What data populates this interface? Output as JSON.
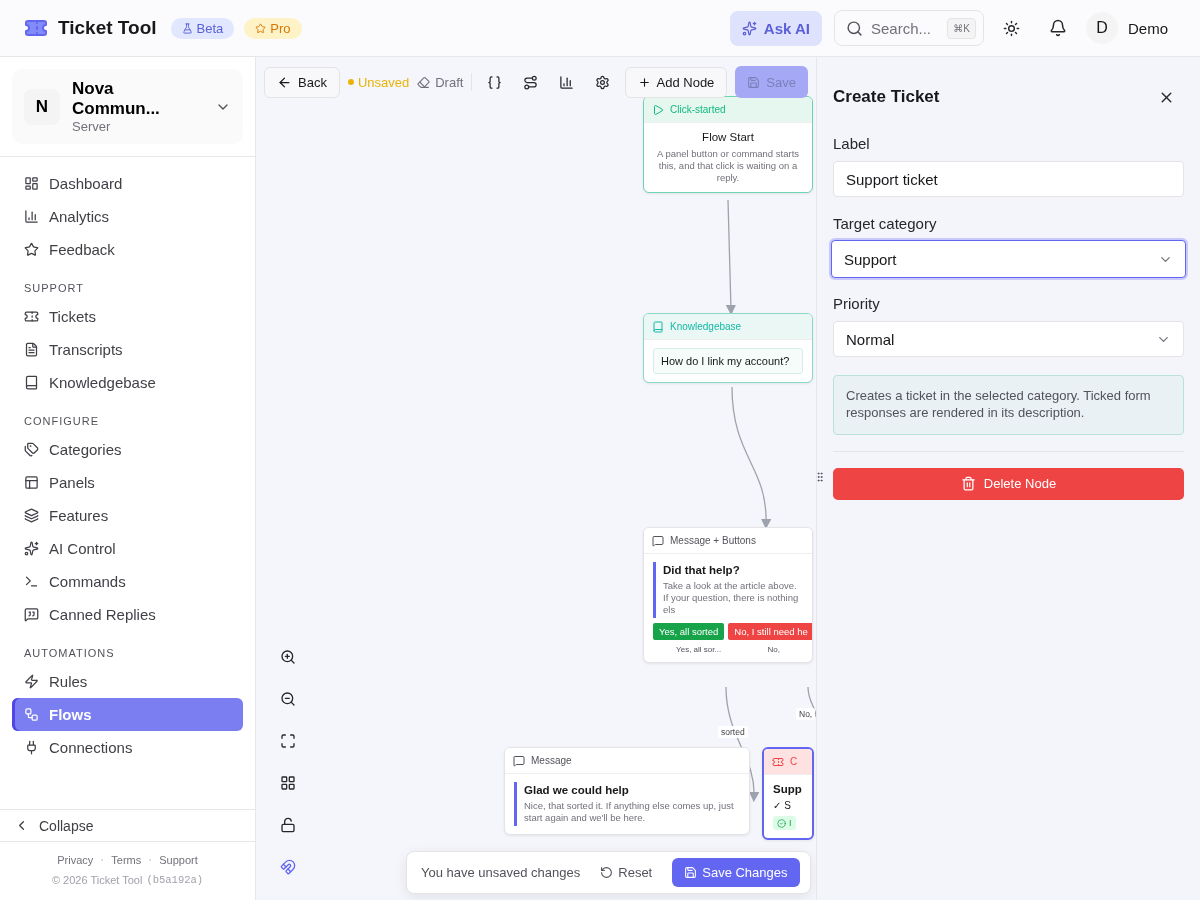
{
  "header": {
    "brand": "Ticket Tool",
    "badges": [
      {
        "kind": "beta",
        "label": "Beta"
      },
      {
        "kind": "pro",
        "label": "Pro"
      }
    ],
    "ask_ai": "Ask AI",
    "search": {
      "placeholder": "Search...",
      "shortcut": "⌘K"
    },
    "user": {
      "initial": "D",
      "name": "Demo"
    }
  },
  "sidebar": {
    "workspace": {
      "initial": "N",
      "name": "Nova Commun...",
      "type": "Server"
    },
    "sections": [
      {
        "items": [
          {
            "label": "Dashboard",
            "selected": false
          },
          {
            "label": "Analytics",
            "selected": false
          },
          {
            "label": "Feedback",
            "selected": false
          }
        ]
      },
      {
        "title": "SUPPORT",
        "items": [
          {
            "label": "Tickets",
            "selected": false
          },
          {
            "label": "Transcripts",
            "selected": false
          },
          {
            "label": "Knowledgebase",
            "selected": false
          }
        ]
      },
      {
        "title": "CONFIGURE",
        "items": [
          {
            "label": "Categories",
            "selected": false
          },
          {
            "label": "Panels",
            "selected": false
          },
          {
            "label": "Features",
            "selected": false
          },
          {
            "label": "AI Control",
            "selected": false
          },
          {
            "label": "Commands",
            "selected": false
          },
          {
            "label": "Canned Replies",
            "selected": false
          }
        ]
      },
      {
        "title": "AUTOMATIONS",
        "items": [
          {
            "label": "Rules",
            "selected": false
          },
          {
            "label": "Flows",
            "selected": true
          },
          {
            "label": "Connections",
            "selected": false
          }
        ]
      }
    ],
    "collapse": "Collapse",
    "footer_links": [
      "Privacy",
      "Terms",
      "Support"
    ],
    "copyright": "© 2026 Ticket Tool",
    "build": "(b5a192a)"
  },
  "toolbar": {
    "back": "Back",
    "status": "Unsaved",
    "draft": "Draft",
    "add_node": "Add Node",
    "save": {
      "label": "Save",
      "disabled": true
    }
  },
  "nodes": [
    {
      "kind": "trigger",
      "header": "Click-started",
      "title": "Flow Start",
      "text": "A panel button or command starts this, and that click is waiting on a reply."
    },
    {
      "kind": "knowledgebase",
      "header": "Knowledgebase",
      "question": "How do I link my account?"
    },
    {
      "kind": "message_buttons",
      "header": "Message + Buttons",
      "title": "Did that help?",
      "text": "Take a look at the article above. If your question, there is nothing els",
      "buttons": [
        {
          "label": "Yes, all sorted",
          "color": "#16a34a"
        },
        {
          "label": "No, I still need he",
          "color": "#ef4444"
        }
      ],
      "outputs": [
        "Yes, all sor...",
        "No,"
      ]
    },
    {
      "kind": "message",
      "header": "Message",
      "title": "Glad we could help",
      "text": "Nice, that sorted it. If anything else comes up, just start again and we'll be here."
    },
    {
      "kind": "create_ticket",
      "header": "C",
      "title": "Supp",
      "lines": [
        "✓ S"
      ],
      "badge": "I"
    }
  ],
  "edge_labels": [
    "No,",
    "sorted"
  ],
  "unsaved_bar": {
    "text": "You have unsaved changes",
    "reset": "Reset",
    "save": "Save Changes"
  },
  "panel": {
    "title": "Create Ticket",
    "fields": [
      {
        "kind": "text",
        "label": "Label",
        "value": "Support ticket",
        "focused": false
      },
      {
        "kind": "select",
        "label": "Target category",
        "value": "Support",
        "focused": true
      },
      {
        "kind": "select",
        "label": "Priority",
        "value": "Normal",
        "focused": false
      }
    ],
    "info": "Creates a ticket in the selected category. Ticked form responses are rendered in its description.",
    "delete": "Delete Node"
  }
}
